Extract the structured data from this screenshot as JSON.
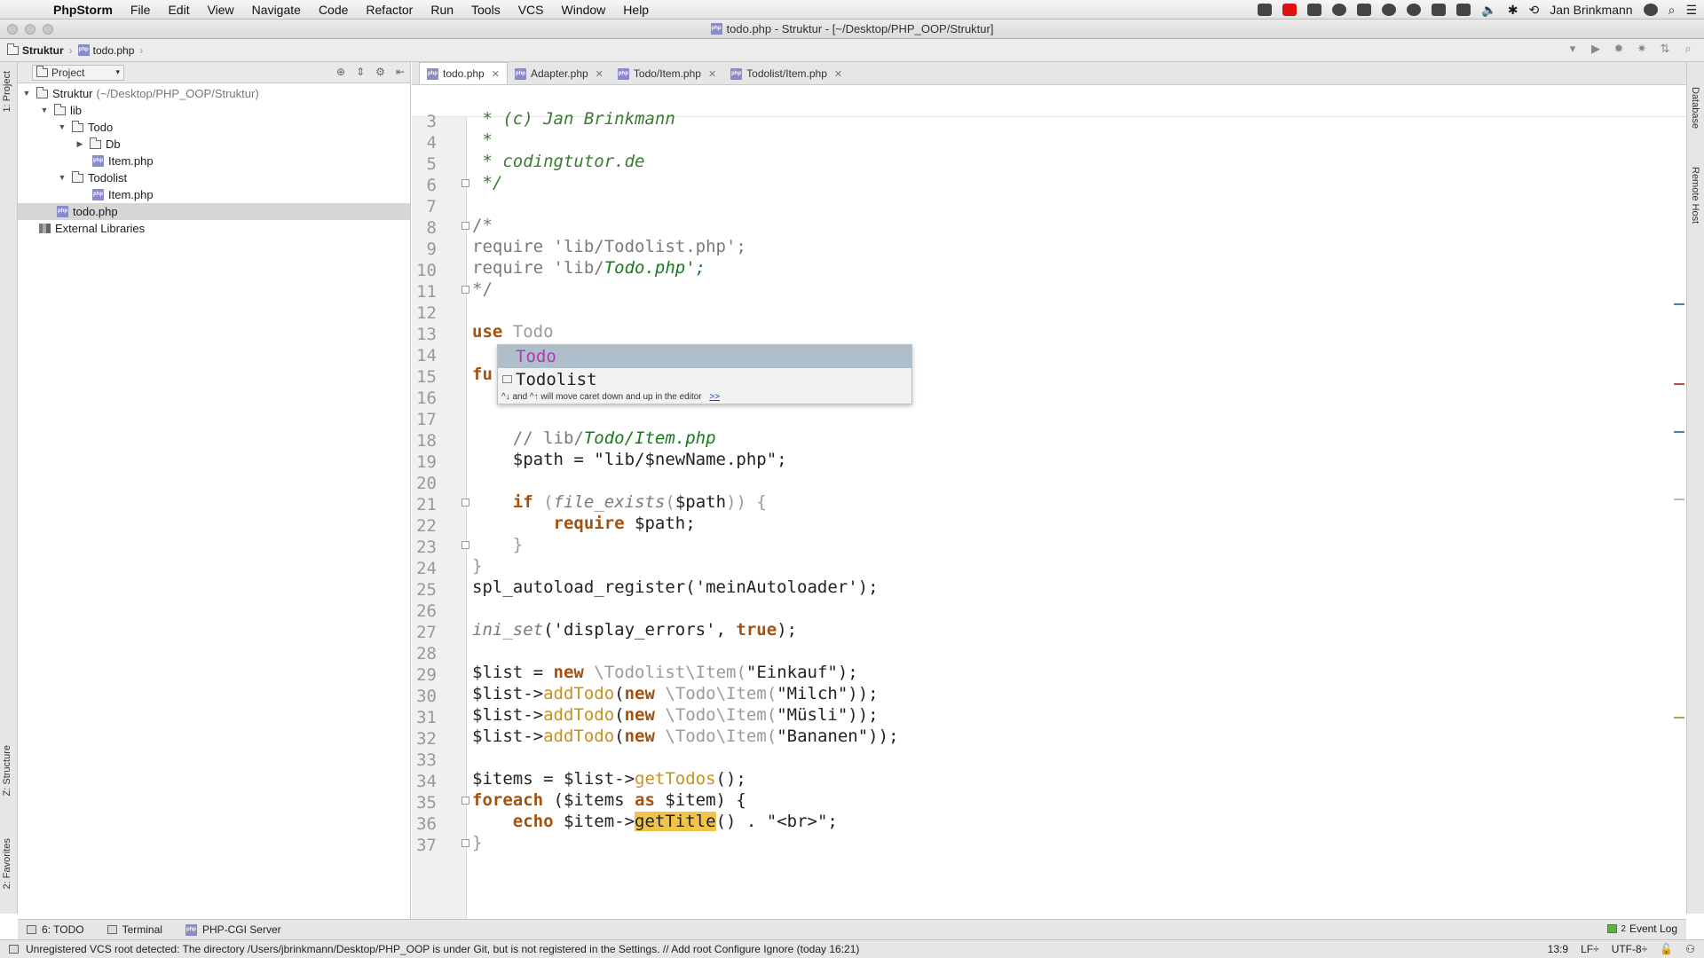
{
  "menubar": {
    "app": "PhpStorm",
    "items": [
      "File",
      "Edit",
      "View",
      "Navigate",
      "Code",
      "Refactor",
      "Run",
      "Tools",
      "VCS",
      "Window",
      "Help"
    ],
    "user": "Jan Brinkmann"
  },
  "window": {
    "title": "todo.php - Struktur - [~/Desktop/PHP_OOP/Struktur]"
  },
  "navbar": {
    "crumb_project": "Struktur",
    "crumb_file": "todo.php"
  },
  "project_panel": {
    "selector_label": "Project",
    "tree": [
      {
        "label": "Struktur",
        "extra": "(~/Desktop/PHP_OOP/Struktur)",
        "type": "folder",
        "depth": 0,
        "expanded": true
      },
      {
        "label": "lib",
        "type": "folder",
        "depth": 1,
        "expanded": true
      },
      {
        "label": "Todo",
        "type": "folder",
        "depth": 2,
        "expanded": true
      },
      {
        "label": "Db",
        "type": "folder",
        "depth": 3,
        "expanded": false
      },
      {
        "label": "Item.php",
        "type": "php",
        "depth": 3
      },
      {
        "label": "Todolist",
        "type": "folder",
        "depth": 2,
        "expanded": true
      },
      {
        "label": "Item.php",
        "type": "php",
        "depth": 3
      },
      {
        "label": "todo.php",
        "type": "php",
        "depth": 1,
        "selected": true
      },
      {
        "label": "External Libraries",
        "type": "lib",
        "depth": 0
      }
    ]
  },
  "editor": {
    "tabs": [
      {
        "label": "todo.php",
        "active": true
      },
      {
        "label": "Adapter.php",
        "active": false
      },
      {
        "label": "Todo/Item.php",
        "active": false
      },
      {
        "label": "Todolist/Item.php",
        "active": false
      }
    ],
    "line_numbers": [
      "3",
      "4",
      "5",
      "6",
      "7",
      "8",
      "9",
      "10",
      "11",
      "12",
      "13",
      "14",
      "15",
      "16",
      "17",
      "18",
      "19",
      "20",
      "21",
      "22",
      "23",
      "24",
      "25",
      "26",
      "27",
      "28",
      "29",
      "30",
      "31",
      "32",
      "33",
      "34",
      "35",
      "36",
      "37"
    ]
  },
  "autocomplete": {
    "items": [
      {
        "match": "Todo",
        "rest": ""
      },
      {
        "match": "Todo",
        "rest": "list"
      }
    ],
    "hint": "^↓ and ^↑ will move caret down and up in the editor",
    "hint_link": ">>"
  },
  "left_strip": {
    "project": "1: Project",
    "structure": "Z: Structure",
    "favorites": "2: Favorites"
  },
  "right_strip": {
    "database": "Database",
    "remote": "Remote Host"
  },
  "bottom_tabs": {
    "todo": "6: TODO",
    "terminal": "Terminal",
    "server": "PHP-CGI Server",
    "event_log": "Event Log",
    "event_count": "2"
  },
  "status": {
    "message": "Unregistered VCS root detected: The directory /Users/jbrinkmann/Desktop/PHP_OOP is under Git, but is not registered in the Settings. // Add root  Configure  Ignore (today 16:21)",
    "position": "13:9",
    "line_sep": "LF÷",
    "encoding": "UTF-8÷"
  },
  "colors": {
    "popup_selected": "#afbecb",
    "highlight": "#f0c34a",
    "keyword": "#a3520f",
    "comment": "#3b7a33"
  }
}
